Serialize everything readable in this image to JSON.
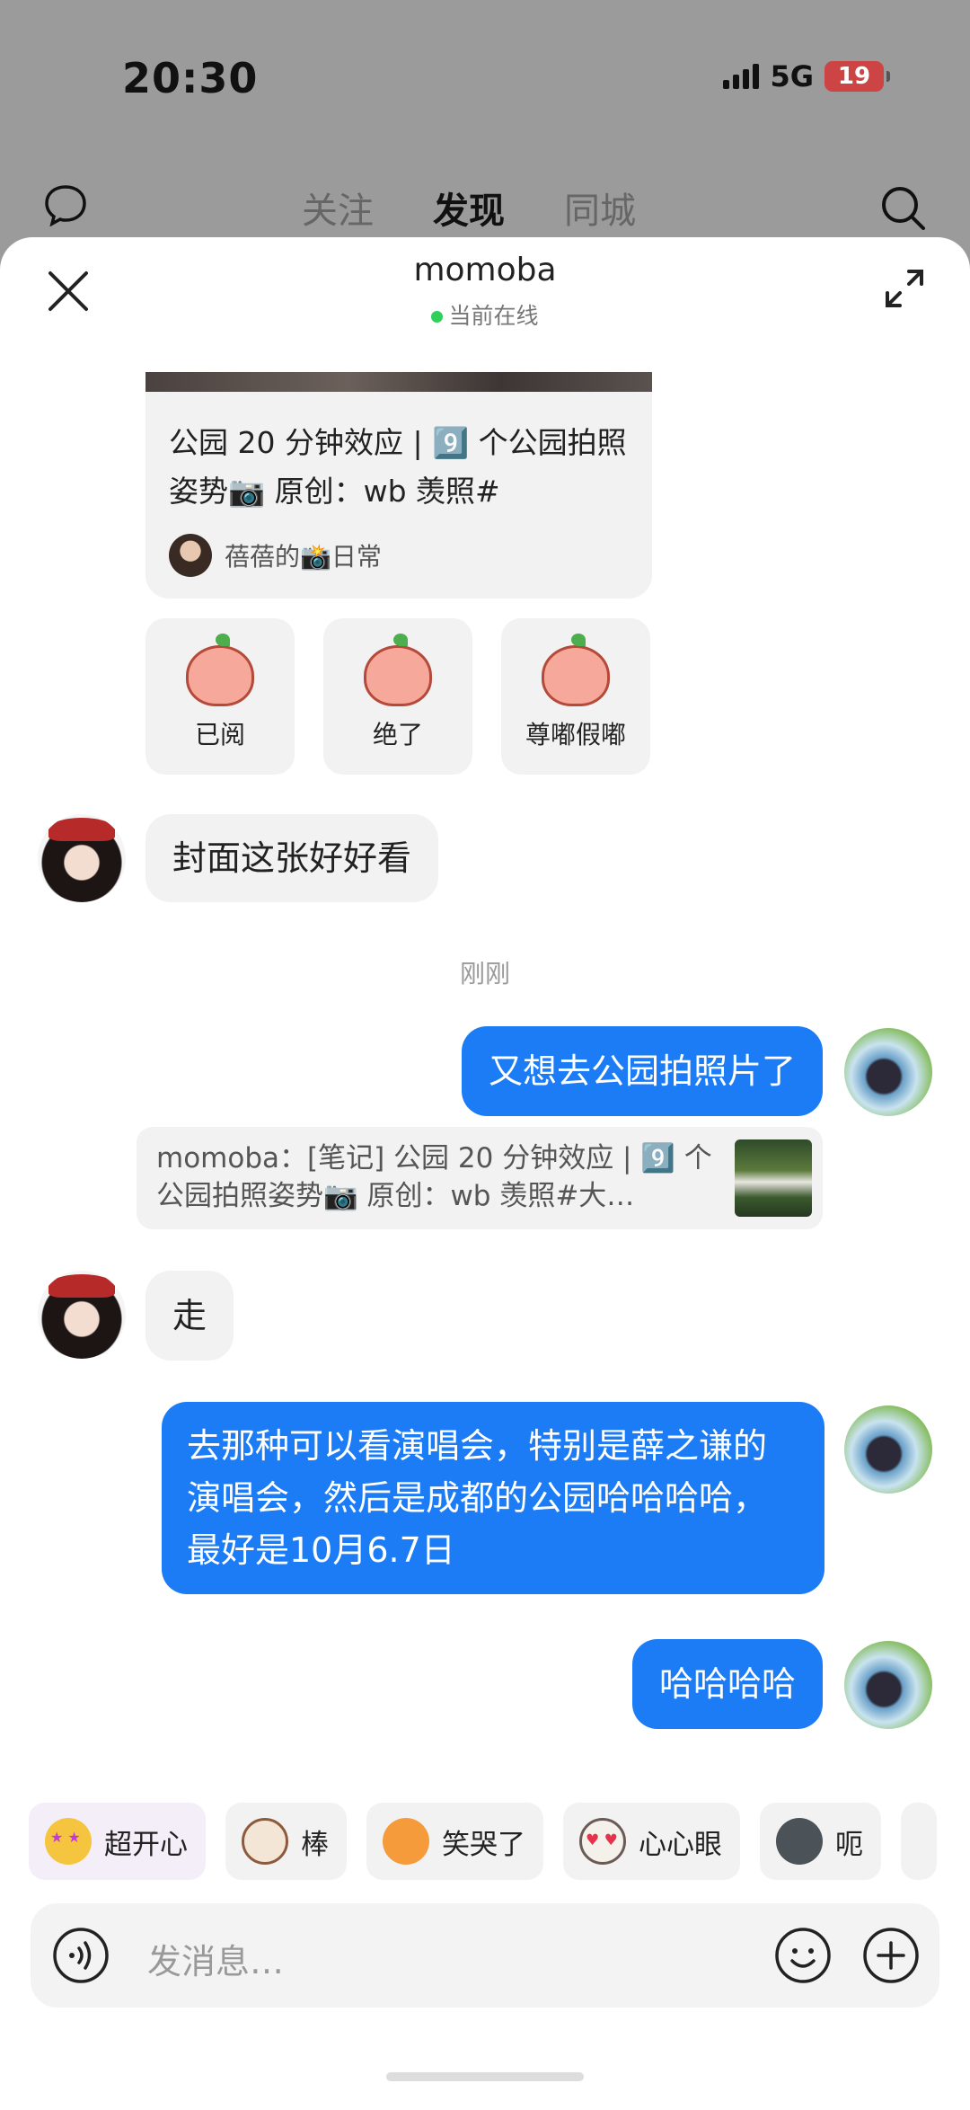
{
  "status_bar": {
    "time": "20:30",
    "network": "5G",
    "battery": "19"
  },
  "background_nav": {
    "tabs": [
      "关注",
      "发现",
      "同城"
    ],
    "active_tab": "发现"
  },
  "chat": {
    "name": "momoba",
    "presence": "当前在线"
  },
  "shared_note": {
    "title": "公园 20 分钟效应 | 9️⃣ 个公园拍照姿势📷 原创：wb 羡照#",
    "author": "蓓蓓的📸日常"
  },
  "sticker_replies": [
    {
      "label": "已阅"
    },
    {
      "label": "绝了"
    },
    {
      "label": "尊嘟假嘟"
    }
  ],
  "messages": {
    "m1": "封面这张好好看",
    "timestamp": "刚刚",
    "m2": "又想去公园拍照片了",
    "quote": "momoba：[笔记] 公园 20 分钟效应 | 9️⃣ 个公园拍照姿势📷 原创：wb 羡照#大…",
    "m3": "走",
    "m4": "去那种可以看演唱会，特别是薛之谦的演唱会，然后是成都的公园哈哈哈哈，最好是10月6.7日",
    "m5": "哈哈哈哈"
  },
  "quick_reactions": [
    {
      "label": "超开心",
      "icon": "star-eyes-emoji-icon"
    },
    {
      "label": "棒",
      "icon": "thumbs-cat-icon"
    },
    {
      "label": "笑哭了",
      "icon": "laughing-cat-icon"
    },
    {
      "label": "心心眼",
      "icon": "heart-eyes-cat-icon"
    },
    {
      "label": "呃",
      "icon": "awkward-cat-icon"
    }
  ],
  "input": {
    "placeholder": "发消息…"
  }
}
